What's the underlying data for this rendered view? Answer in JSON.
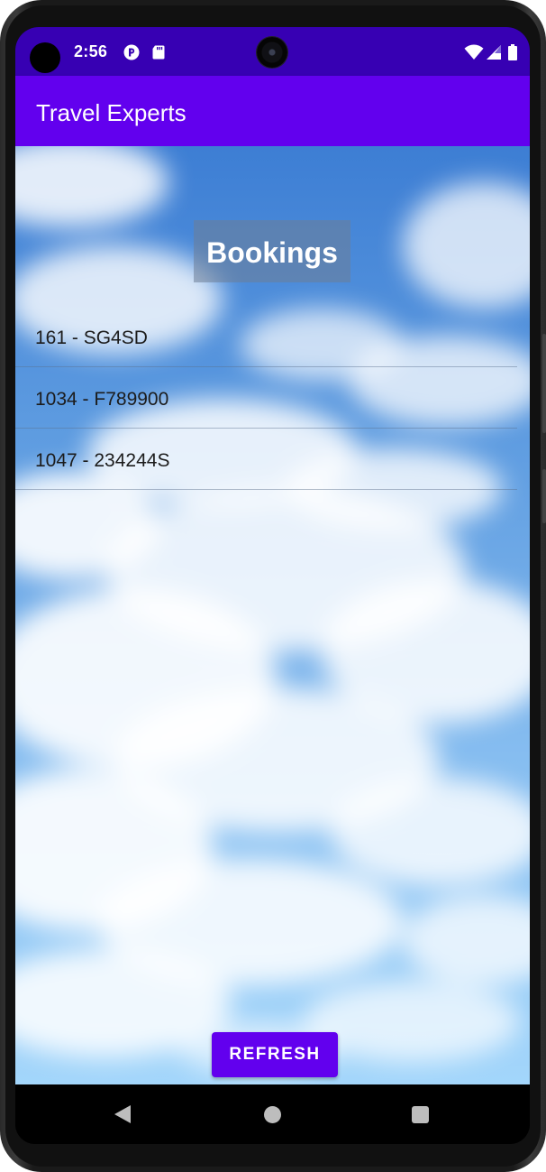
{
  "status_bar": {
    "time": "2:56",
    "icons": [
      "camera-cutout-icon",
      "notification-icon",
      "sd-card-icon",
      "wifi-icon",
      "cell-signal-icon",
      "battery-icon"
    ]
  },
  "app_bar": {
    "title": "Travel Experts"
  },
  "main": {
    "heading": "Bookings",
    "bookings": [
      {
        "label": "161 - SG4SD"
      },
      {
        "label": "1034 - F789900"
      },
      {
        "label": "1047 - 234244S"
      }
    ],
    "refresh_label": "REFRESH"
  },
  "nav_bar": {
    "icons": [
      "back-icon",
      "home-icon",
      "recents-icon"
    ]
  },
  "colors": {
    "status_bar": "#3700b3",
    "app_bar": "#6200ee",
    "button": "#6200ee"
  }
}
